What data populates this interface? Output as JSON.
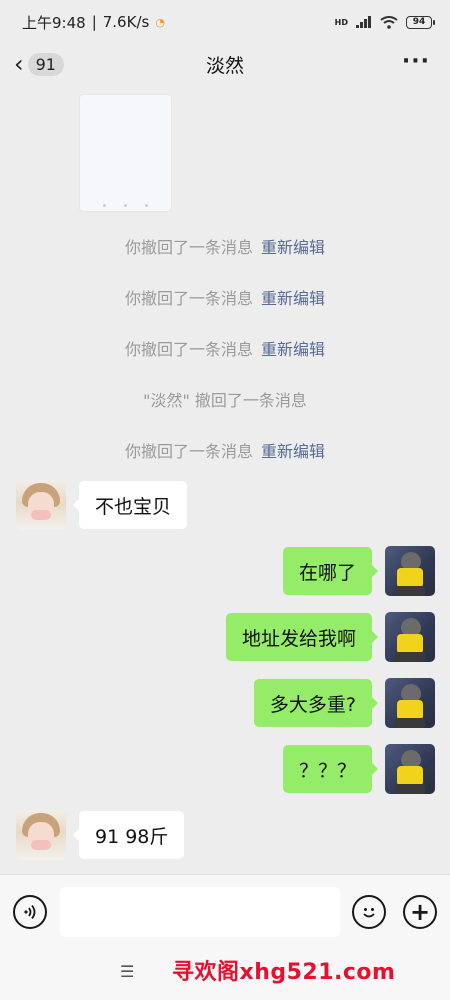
{
  "status_bar": {
    "time": "上午9:48",
    "network_speed": "7.6K/s",
    "signal_label": "HD",
    "battery": "94"
  },
  "nav": {
    "unread_count": "91",
    "title": "淡然"
  },
  "system_messages": [
    {
      "text": "你撤回了一条消息",
      "edit": "重新编辑"
    },
    {
      "text": "你撤回了一条消息",
      "edit": "重新编辑"
    },
    {
      "text": "你撤回了一条消息",
      "edit": "重新编辑"
    },
    {
      "text": "\"淡然\" 撤回了一条消息",
      "edit": ""
    },
    {
      "text": "你撤回了一条消息",
      "edit": "重新编辑"
    }
  ],
  "messages": [
    {
      "side": "left",
      "text": "不也宝贝"
    },
    {
      "side": "right",
      "text": "在哪了"
    },
    {
      "side": "right",
      "text": "地址发给我啊"
    },
    {
      "side": "right",
      "text": "多大多重?"
    },
    {
      "side": "right",
      "text": "？？？"
    },
    {
      "side": "left",
      "text": "91  98斤"
    }
  ],
  "input": {
    "placeholder": ""
  },
  "bottom": {
    "watermark": "寻欢阁xhg521.com"
  },
  "colors": {
    "background": "#ededed",
    "bubble_self": "#95ec69",
    "bubble_other": "#ffffff",
    "link": "#576b95",
    "watermark": "#e8102f"
  }
}
